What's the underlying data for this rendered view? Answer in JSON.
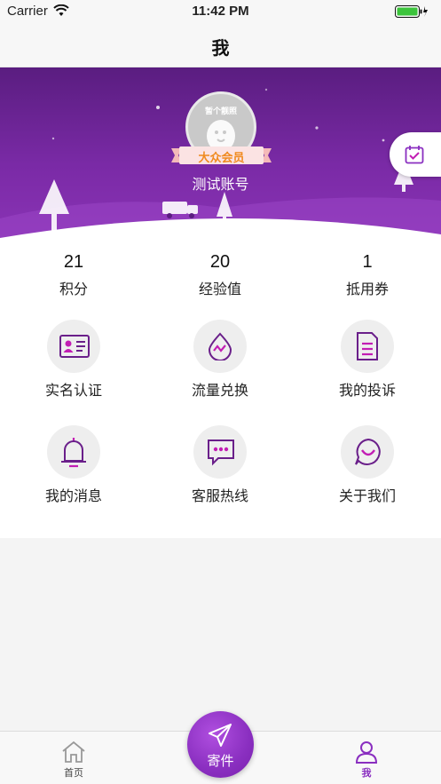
{
  "status_bar": {
    "carrier": "Carrier",
    "time": "11:42 PM"
  },
  "nav": {
    "title": "我"
  },
  "profile": {
    "avatar_text": "暂个靓照",
    "member_level": "大众会员",
    "account_name": "测试账号",
    "checkin_icon": "calendar-check-icon"
  },
  "stats": [
    {
      "value": "21",
      "label": "积分"
    },
    {
      "value": "20",
      "label": "经验值"
    },
    {
      "value": "1",
      "label": "抵用券"
    }
  ],
  "features": [
    {
      "label": "实名认证",
      "icon": "id-card-icon"
    },
    {
      "label": "流量兑换",
      "icon": "data-drop-icon"
    },
    {
      "label": "我的投诉",
      "icon": "document-icon"
    },
    {
      "label": "我的消息",
      "icon": "bell-icon"
    },
    {
      "label": "客服热线",
      "icon": "chat-bubble-icon"
    },
    {
      "label": "关于我们",
      "icon": "smile-icon"
    }
  ],
  "tab_bar": {
    "home_label": "首页",
    "send_label": "寄件",
    "me_label": "我"
  },
  "colors": {
    "brand_purple": "#8a2fc0",
    "icon_magenta": "#c21db4",
    "badge_orange": "#f08a1e",
    "hero_dark": "#5a1d80"
  }
}
